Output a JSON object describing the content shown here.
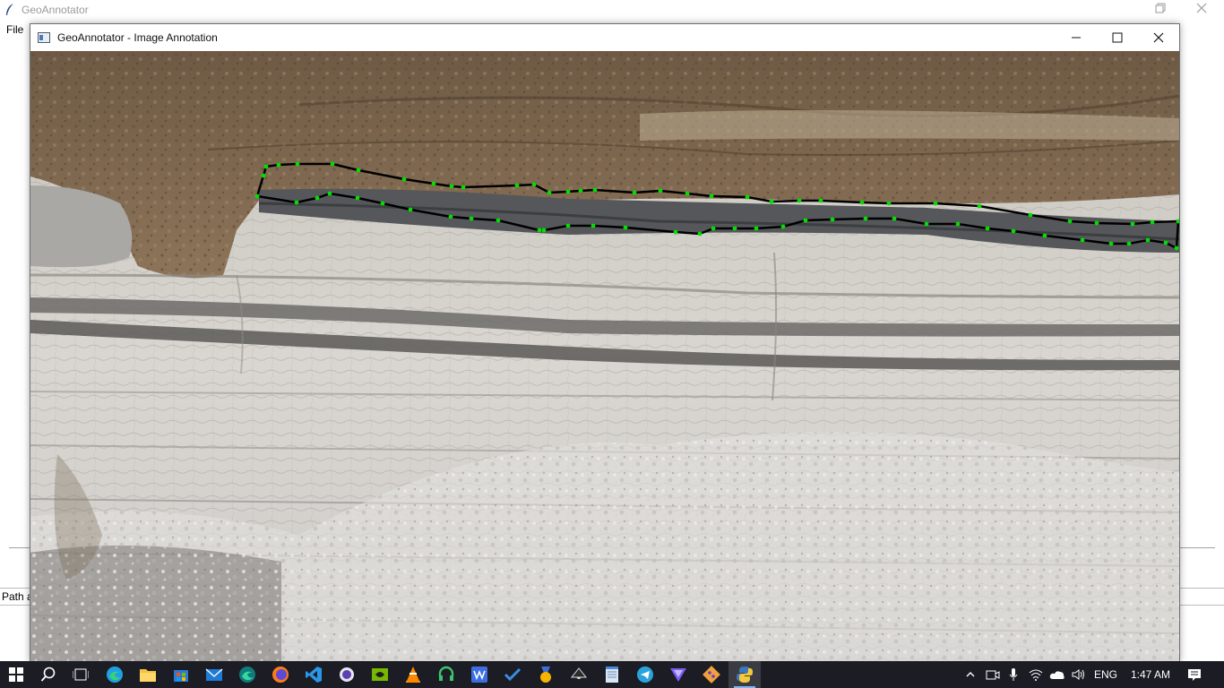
{
  "background_app": {
    "title": "GeoAnnotator",
    "menu": {
      "file_label": "File"
    },
    "status_text": "Path a"
  },
  "window": {
    "title": "GeoAnnotator - Image Annotation",
    "controls": [
      "minimize",
      "maximize",
      "close"
    ]
  },
  "annotation": {
    "stroke_color": "#000000",
    "point_color": "#00e000"
  },
  "taskbar": {
    "apps": [
      "start-icon",
      "search-icon",
      "task-view-icon",
      "edge-icon",
      "file-explorer-icon",
      "store-icon",
      "mail-icon",
      "edge-dev-icon",
      "firefox-icon",
      "vscode-icon",
      "obs-icon",
      "nvidia-icon",
      "vlc-icon",
      "headset-icon",
      "wps-icon",
      "todo-icon",
      "award-icon",
      "inkscape-icon",
      "notepad-icon",
      "telegram-icon",
      "proton-icon",
      "git-icon",
      "python-icon"
    ],
    "language": "ENG",
    "time": "1:47 AM"
  }
}
